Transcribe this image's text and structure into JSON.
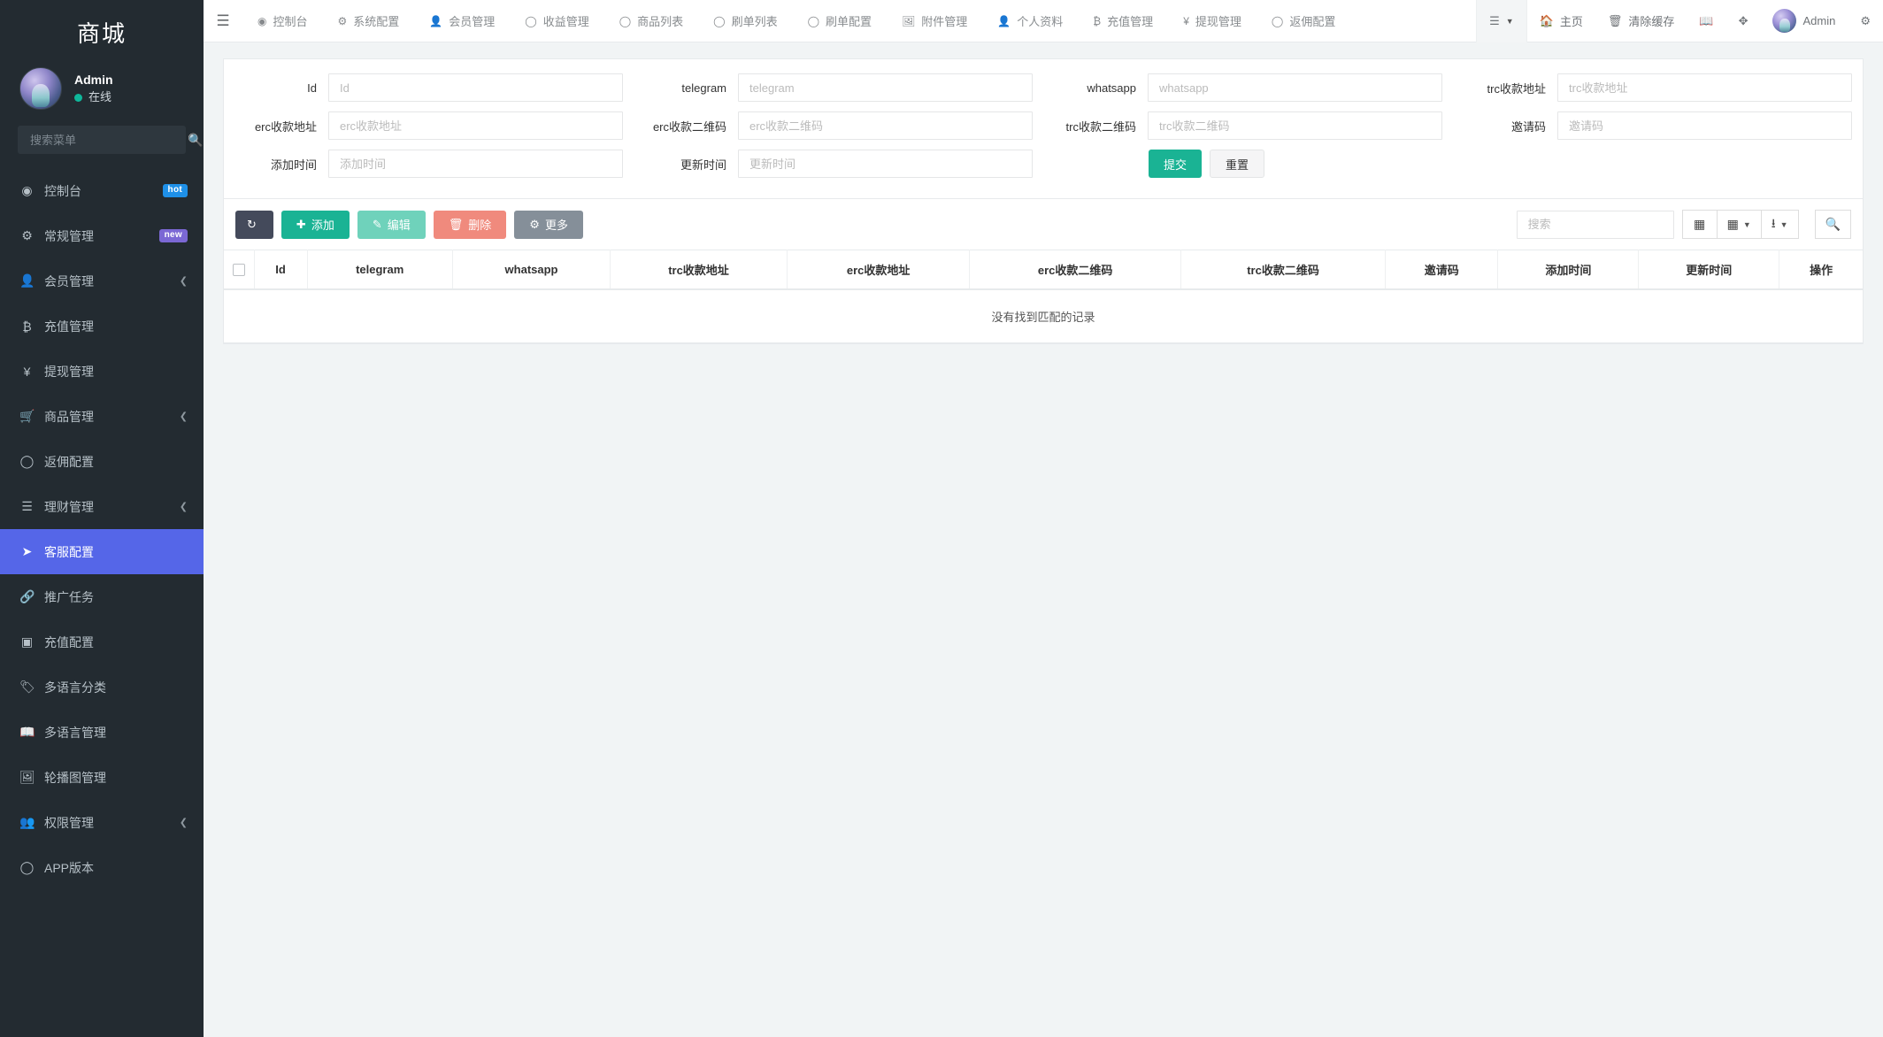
{
  "sidebar": {
    "brand": "商城",
    "profile": {
      "name": "Admin",
      "status": "在线"
    },
    "search_placeholder": "搜索菜单",
    "items": [
      {
        "label": "控制台",
        "icon": "dashboard-icon",
        "glyph": "◉",
        "badge": "hot",
        "badge_type": "hot",
        "caret": false,
        "active": false
      },
      {
        "label": "常规管理",
        "icon": "cogs-icon",
        "glyph": "⚙",
        "badge": "new",
        "badge_type": "new",
        "caret": false,
        "active": false
      },
      {
        "label": "会员管理",
        "icon": "user-icon",
        "glyph": "👤",
        "badge": "",
        "badge_type": "",
        "caret": true,
        "active": false
      },
      {
        "label": "充值管理",
        "icon": "bitcoin-icon",
        "glyph": "₿",
        "badge": "",
        "badge_type": "",
        "caret": false,
        "active": false
      },
      {
        "label": "提现管理",
        "icon": "yen-icon",
        "glyph": "¥",
        "badge": "",
        "badge_type": "",
        "caret": false,
        "active": false
      },
      {
        "label": "商品管理",
        "icon": "cart-icon",
        "glyph": "🛒",
        "badge": "",
        "badge_type": "",
        "caret": true,
        "active": false
      },
      {
        "label": "返佣配置",
        "icon": "circle-icon",
        "glyph": "◯",
        "badge": "",
        "badge_type": "",
        "caret": false,
        "active": false
      },
      {
        "label": "理财管理",
        "icon": "list-icon",
        "glyph": "☰",
        "badge": "",
        "badge_type": "",
        "caret": true,
        "active": false
      },
      {
        "label": "客服配置",
        "icon": "telegram-icon",
        "glyph": "➤",
        "badge": "",
        "badge_type": "",
        "caret": false,
        "active": true
      },
      {
        "label": "推广任务",
        "icon": "link-icon",
        "glyph": "🔗",
        "badge": "",
        "badge_type": "",
        "caret": false,
        "active": false
      },
      {
        "label": "充值配置",
        "icon": "cc-icon",
        "glyph": "▣",
        "badge": "",
        "badge_type": "",
        "caret": false,
        "active": false
      },
      {
        "label": "多语言分类",
        "icon": "tag-icon",
        "glyph": "🏷",
        "badge": "",
        "badge_type": "",
        "caret": false,
        "active": false
      },
      {
        "label": "多语言管理",
        "icon": "book-icon",
        "glyph": "📖",
        "badge": "",
        "badge_type": "",
        "caret": false,
        "active": false
      },
      {
        "label": "轮播图管理",
        "icon": "image-icon",
        "glyph": "🖼",
        "badge": "",
        "badge_type": "",
        "caret": false,
        "active": false
      },
      {
        "label": "权限管理",
        "icon": "users-icon",
        "glyph": "👥",
        "badge": "",
        "badge_type": "",
        "caret": true,
        "active": false
      },
      {
        "label": "APP版本",
        "icon": "circle-icon",
        "glyph": "◯",
        "badge": "",
        "badge_type": "",
        "caret": false,
        "active": false
      }
    ]
  },
  "topbar": {
    "menu_toggle": "☰",
    "nav": [
      {
        "label": "控制台",
        "icon": "dashboard-icon",
        "glyph": "◉"
      },
      {
        "label": "系统配置",
        "icon": "gear-icon",
        "glyph": "⚙"
      },
      {
        "label": "会员管理",
        "icon": "user-icon",
        "glyph": "👤"
      },
      {
        "label": "收益管理",
        "icon": "circle-icon",
        "glyph": "◯"
      },
      {
        "label": "商品列表",
        "icon": "circle-icon",
        "glyph": "◯"
      },
      {
        "label": "刷单列表",
        "icon": "circle-icon",
        "glyph": "◯"
      },
      {
        "label": "刷单配置",
        "icon": "circle-icon",
        "glyph": "◯"
      },
      {
        "label": "附件管理",
        "icon": "image-icon",
        "glyph": "🖼"
      },
      {
        "label": "个人资料",
        "icon": "user-icon",
        "glyph": "👤"
      },
      {
        "label": "充值管理",
        "icon": "bitcoin-icon",
        "glyph": "₿"
      },
      {
        "label": "提现管理",
        "icon": "yen-icon",
        "glyph": "¥"
      },
      {
        "label": "返佣配置",
        "icon": "circle-icon",
        "glyph": "◯"
      }
    ],
    "right": {
      "layout_label": "",
      "home_label": "主页",
      "clear_cache_label": "清除缓存",
      "user_label": "Admin"
    }
  },
  "search_form": {
    "fields": [
      {
        "label": "Id",
        "placeholder": "Id",
        "value": ""
      },
      {
        "label": "telegram",
        "placeholder": "telegram",
        "value": ""
      },
      {
        "label": "whatsapp",
        "placeholder": "whatsapp",
        "value": ""
      },
      {
        "label": "trc收款地址",
        "placeholder": "trc收款地址",
        "value": ""
      },
      {
        "label": "erc收款地址",
        "placeholder": "erc收款地址",
        "value": ""
      },
      {
        "label": "erc收款二维码",
        "placeholder": "erc收款二维码",
        "value": ""
      },
      {
        "label": "trc收款二维码",
        "placeholder": "trc收款二维码",
        "value": ""
      },
      {
        "label": "邀请码",
        "placeholder": "邀请码",
        "value": ""
      },
      {
        "label": "添加时间",
        "placeholder": "添加时间",
        "value": ""
      },
      {
        "label": "更新时间",
        "placeholder": "更新时间",
        "value": ""
      }
    ],
    "submit_label": "提交",
    "reset_label": "重置"
  },
  "toolbar": {
    "refresh_label": "",
    "add_label": "添加",
    "edit_label": "编辑",
    "delete_label": "删除",
    "more_label": "更多",
    "search_placeholder": "搜索",
    "search_value": ""
  },
  "table": {
    "columns": [
      "Id",
      "telegram",
      "whatsapp",
      "trc收款地址",
      "erc收款地址",
      "erc收款二维码",
      "trc收款二维码",
      "邀请码",
      "添加时间",
      "更新时间",
      "操作"
    ],
    "rows": [],
    "empty_text": "没有找到匹配的记录"
  },
  "colors": {
    "sidebar_bg": "#232b31",
    "active_item": "#5566e8",
    "primary_green": "#1ab394",
    "danger": "#f08a7d",
    "badge_hot": "#1e90e8",
    "badge_new": "#7b68d4"
  }
}
